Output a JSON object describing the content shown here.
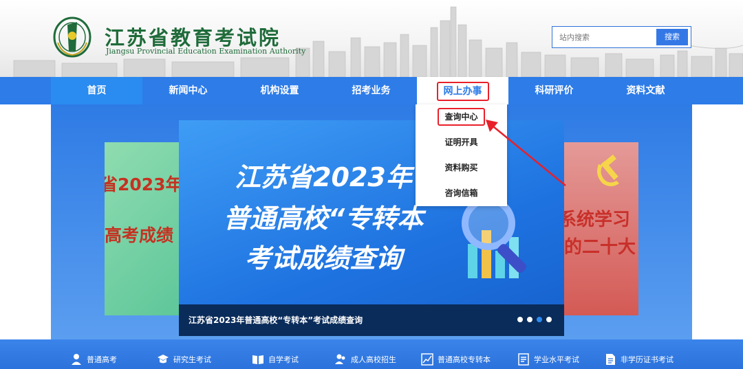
{
  "header": {
    "logo_cn": "江苏省教育考试院",
    "logo_en": "Jiangsu Provincial Education Examination Authority",
    "search_placeholder": "站内搜索",
    "search_button": "搜索"
  },
  "nav": {
    "items": [
      {
        "label": "首页"
      },
      {
        "label": "新闻中心"
      },
      {
        "label": "机构设置"
      },
      {
        "label": "招考业务"
      },
      {
        "label": "网上办事"
      },
      {
        "label": "科研评价"
      },
      {
        "label": "资料文献"
      }
    ]
  },
  "dropdown": {
    "items": [
      {
        "label": "查询中心"
      },
      {
        "label": "证明开具"
      },
      {
        "label": "资料购买"
      },
      {
        "label": "咨询信箱"
      }
    ]
  },
  "banner": {
    "line1": "江苏省2023年",
    "line2": "普通高校“专转本",
    "line3": "考试成绩查询",
    "caption": "江苏省2023年普通高校“专转本”考试成绩查询",
    "left_line1": "省2023年",
    "left_line2": "高考成绩",
    "right_line1": "系统学习",
    "right_line2": "的二十大"
  },
  "bottom_links": [
    {
      "label": "普通高考",
      "icon": "person-icon"
    },
    {
      "label": "研究生考试",
      "icon": "graduation-cap-icon"
    },
    {
      "label": "自学考试",
      "icon": "book-icon"
    },
    {
      "label": "成人高校招生",
      "icon": "users-icon"
    },
    {
      "label": "普通高校专转本",
      "icon": "chart-icon"
    },
    {
      "label": "学业水平考试",
      "icon": "checklist-icon"
    },
    {
      "label": "非学历证书考试",
      "icon": "document-icon"
    }
  ],
  "colors": {
    "brand_green": "#1f6b3a",
    "nav_blue": "#2d7ce8",
    "highlight_red": "#e8202a"
  }
}
